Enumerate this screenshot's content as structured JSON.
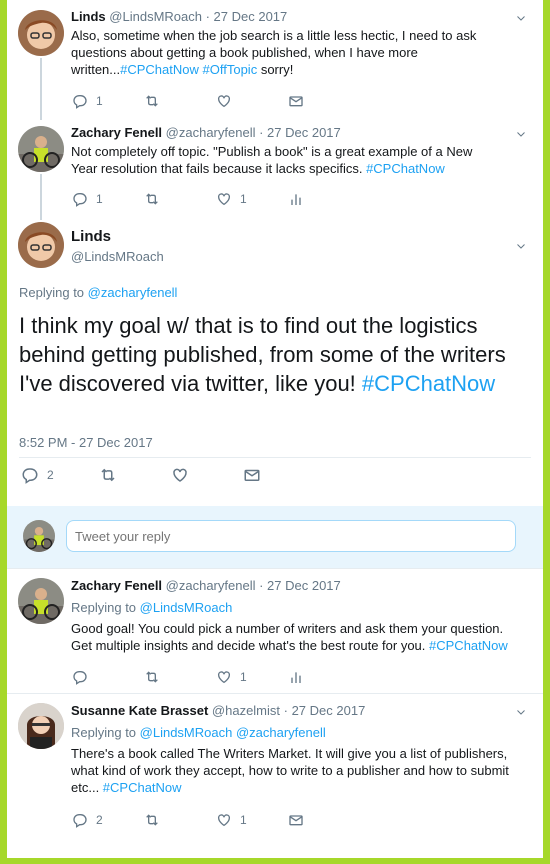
{
  "tweets": [
    {
      "name": "Linds",
      "handle": "@LindsMRoach",
      "date": "· 27 Dec 2017",
      "text_pre": "Also, sometime when the job search is a little less hectic, I need to ask questions about getting a book published, when I have more written...",
      "tag1": "#CPChatNow",
      "tag2": "#OffTopic",
      "text_post": " sorry!",
      "replies": "1",
      "retweets": "",
      "likes": ""
    },
    {
      "name": "Zachary Fenell",
      "handle": "@zacharyfenell",
      "date": "· 27 Dec 2017",
      "text_pre": "Not completely off topic. \"Publish a book\" is a great example of a New Year resolution that fails because it lacks specifics. ",
      "tag1": "#CPChatNow",
      "replies": "1",
      "retweets": "",
      "likes": "1"
    }
  ],
  "main_tweet": {
    "name": "Linds",
    "handle": "@LindsMRoach",
    "replying_label": "Replying to ",
    "replying_handle": "@zacharyfenell",
    "text_pre": "I think my goal w/ that is to find out the logistics behind getting published, from some of the writers I've discovered via twitter, like you! ",
    "tag": "#CPChatNow",
    "timestamp": "8:52 PM - 27 Dec 2017",
    "replies": "2"
  },
  "composer": {
    "placeholder": "Tweet your reply"
  },
  "replies": [
    {
      "name": "Zachary Fenell",
      "handle": "@zacharyfenell",
      "date": "· 27 Dec 2017",
      "replying_label": "Replying to ",
      "replying_handle": "@LindsMRoach",
      "text_pre": "Good goal! You could pick a number of writers and ask them your question. Get multiple insights and decide what's the best route for you. ",
      "tag": "#CPChatNow",
      "replies": "",
      "likes": "1"
    },
    {
      "name": "Susanne Kate Brasset",
      "handle": "@hazelmist",
      "date": "· 27 Dec 2017",
      "replying_label": "Replying to ",
      "replying_handle": "@LindsMRoach",
      "replying_and": " @zacharyfenell",
      "text_pre": "There's a book called The Writers Market. It will give you a list of publishers, what kind of work they accept, how to write to a publisher and how to submit etc... ",
      "tag": "#CPChatNow",
      "replies": "2",
      "likes": "1"
    }
  ],
  "colors": {
    "accent": "#1da1f2",
    "frame": "#a6d82a",
    "muted": "#657786"
  },
  "icons": [
    "reply-icon",
    "retweet-icon",
    "like-icon",
    "dm-icon",
    "analytics-icon",
    "chevron-down-icon"
  ]
}
